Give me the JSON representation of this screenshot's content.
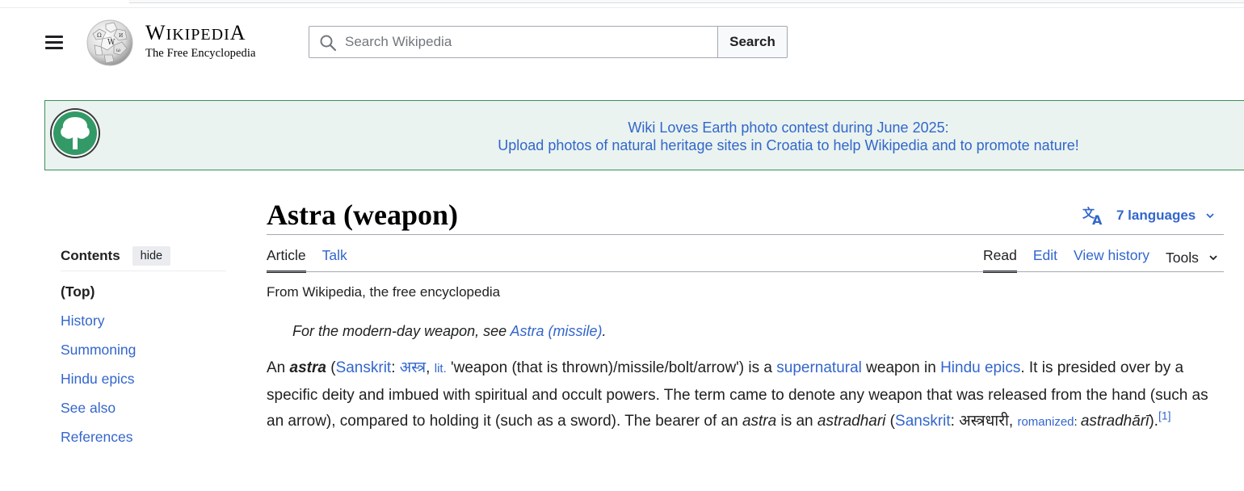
{
  "header": {
    "wordmark_first": "W",
    "wordmark_rest": "IKIPEDI",
    "wordmark_last": "A",
    "tagline": "The Free Encyclopedia",
    "search_placeholder": "Search Wikipedia",
    "search_button": "Search"
  },
  "banner": {
    "line1": "Wiki Loves Earth photo contest during June 2025:",
    "line2": "Upload photos of natural heritage sites in Croatia to help Wikipedia and to promote nature!",
    "accent_color": "#3b8f5a"
  },
  "toc": {
    "title": "Contents",
    "hide_label": "hide",
    "items": [
      {
        "label": "(Top)"
      },
      {
        "label": "History"
      },
      {
        "label": "Summoning"
      },
      {
        "label": "Hindu epics"
      },
      {
        "label": "See also"
      },
      {
        "label": "References"
      }
    ]
  },
  "article": {
    "title": "Astra (weapon)",
    "languages": "7 languages",
    "tabs_left": [
      "Article",
      "Talk"
    ],
    "tabs_right": [
      "Read",
      "Edit",
      "View history",
      "Tools"
    ],
    "from": "From Wikipedia, the free encyclopedia",
    "hatnote_prefix": "For the modern-day weapon, see ",
    "hatnote_link": "Astra (missile)",
    "hatnote_suffix": ".",
    "p1": {
      "t01": "An ",
      "t02": "astra",
      "t03": " (",
      "t04": "Sanskrit",
      "t05": ": ",
      "t06": "अस्त्र",
      "t07": ", ",
      "t08": "lit.",
      "t09": " 'weapon (that is thrown)/missile/bolt/arrow') is a ",
      "t10": "supernatural",
      "t11": " weapon in ",
      "t12": "Hindu epics",
      "t13": ". It is presided over by a specific deity and imbued with spiritual and occult powers. The term came to denote any weapon that was released from the hand (such as an arrow), compared to holding it (such as a sword). The bearer of an ",
      "t14": "astra",
      "t15": " is an ",
      "t16": "astradhari",
      "t17": " (",
      "t18": "Sanskrit",
      "t19": ": अस्त्रधारी, ",
      "t20": "romanized",
      "t21": ": ",
      "t22": "astradhārī",
      "t23": ").",
      "t24": "[1]"
    }
  },
  "icons": {
    "menu": "hamburger-menu-icon",
    "search": "search-icon",
    "language": "language-icon",
    "chevron": "chevron-down-icon",
    "banner": "tree-icon"
  }
}
